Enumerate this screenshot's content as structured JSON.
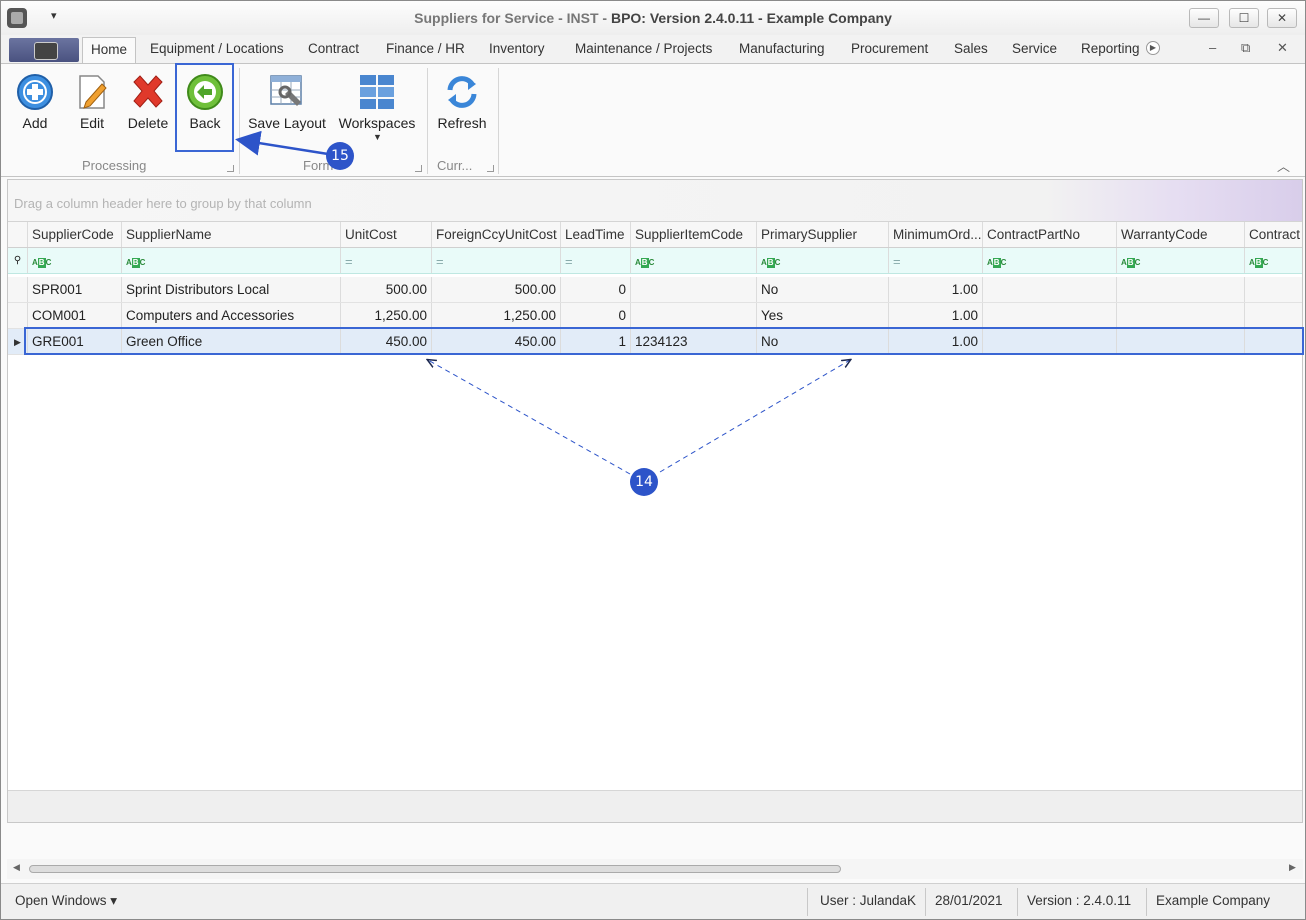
{
  "titlebar": {
    "title_part1": "Suppliers for Service - INST - ",
    "title_part2": "BPO: Version 2.4.0.11 - Example Company",
    "quick_access": "▾",
    "minimize": "—",
    "maximize": "☐",
    "close": "✕"
  },
  "tabs": [
    "Home",
    "Equipment / Locations",
    "Contract",
    "Finance / HR",
    "Inventory",
    "Maintenance / Projects",
    "Manufacturing",
    "Procurement",
    "Sales",
    "Service",
    "Reporting"
  ],
  "mdi": {
    "minimize": "–",
    "restore": "⧉",
    "close": "✕"
  },
  "ribbon": {
    "processing": {
      "label": "Processing",
      "add": "Add",
      "edit": "Edit",
      "delete": "Delete",
      "back": "Back"
    },
    "format": {
      "label": "Form",
      "save_layout": "Save Layout",
      "workspaces": "Workspaces"
    },
    "currency": {
      "label": "Curr...",
      "refresh": "Refresh"
    }
  },
  "grid": {
    "group_hint": "Drag a column header here to group by that column",
    "columns": [
      "SupplierCode",
      "SupplierName",
      "UnitCost",
      "ForeignCcyUnitCost",
      "LeadTime",
      "SupplierItemCode",
      "PrimarySupplier",
      "MinimumOrd...",
      "ContractPartNo",
      "WarrantyCode",
      "Contract"
    ],
    "rows": [
      [
        "SPR001",
        "Sprint Distributors Local",
        "500.00",
        "500.00",
        "0",
        "",
        "No",
        "1.00",
        "",
        "",
        ""
      ],
      [
        "COM001",
        "Computers and Accessories",
        "1,250.00",
        "1,250.00",
        "0",
        "",
        "Yes",
        "1.00",
        "",
        "",
        ""
      ],
      [
        "GRE001",
        "Green Office",
        "450.00",
        "450.00",
        "1",
        "1234123",
        "No",
        "1.00",
        "",
        "",
        ""
      ]
    ]
  },
  "callouts": {
    "back_step": "15",
    "row_step": "14"
  },
  "statusbar": {
    "open_windows": "Open Windows ▾",
    "user": "User : JulandaK",
    "date": "28/01/2021",
    "version": "Version : 2.4.0.11",
    "company": "Example Company"
  },
  "colors": {
    "accent": "#2d54c9",
    "selected_row": "#e2ecf8",
    "filter_row": "#e9fbf9"
  }
}
